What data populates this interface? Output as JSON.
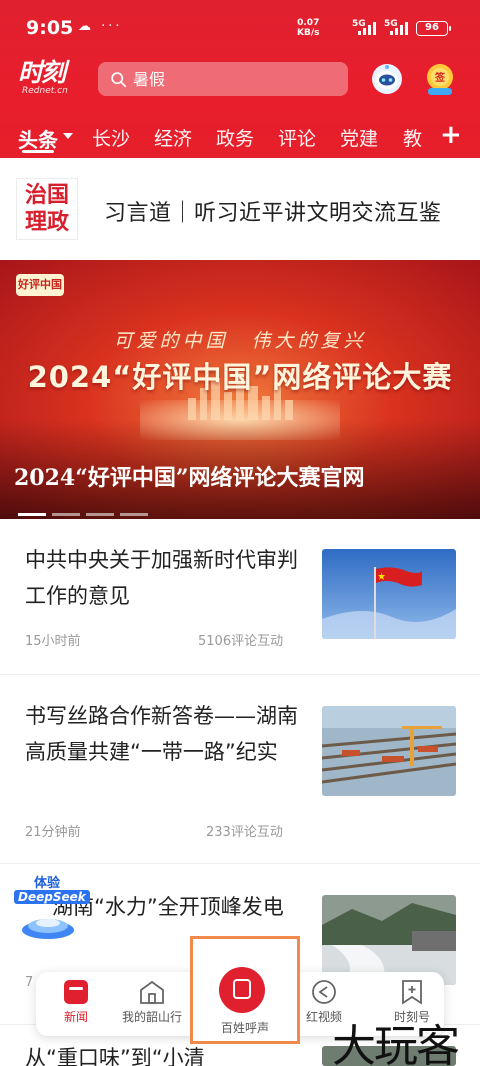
{
  "status_bar": {
    "time": "9:05",
    "notif_icons": "☁ ···",
    "net_speed_top": "0.07",
    "net_speed_bottom": "KB/s",
    "sig1": "5G",
    "sig2": "5G",
    "battery": "96"
  },
  "header": {
    "logo_text": "时刻",
    "logo_sub": "Rednet.cn",
    "search_placeholder": "暑假",
    "robot_icon": "assistant-robot-icon",
    "signin_icon": "signin-badge-icon"
  },
  "channels": [
    "头条",
    "长沙",
    "经济",
    "政务",
    "评论",
    "党建",
    "教"
  ],
  "feature": {
    "badge_line1": "治国",
    "badge_line2": "理政",
    "title": "习言道｜听习近平讲文明交流互鉴"
  },
  "banner": {
    "chip": "好评中国",
    "slogan": "可爱的中国　伟大的复兴",
    "big_title": "2024“好评中国”网络评论大赛",
    "caption": "2024“好评中国”网络评论大赛官网"
  },
  "news": [
    {
      "title": "中共中央关于加强新时代审判工作的意见",
      "time": "15小时前",
      "comments": "5106评论互动"
    },
    {
      "title": "书写丝路合作新答卷——湖南高质量共建“一带一路”纪实",
      "time": "21分钟前",
      "comments": "233评论互动"
    },
    {
      "title": "湖南“水力”全开顶峰发电",
      "time": "7"
    },
    {
      "title": "从“重口味”到“小清"
    }
  ],
  "deepseek": {
    "label_top": "体验",
    "label_brand": "DeepSeek"
  },
  "bottom_nav": {
    "items": [
      "新闻",
      "我的韶山行",
      "百姓呼声",
      "红视频",
      "时刻号"
    ],
    "active": "新闻"
  },
  "watermark": "大玩客",
  "colors": {
    "brand_red": "#e0202f",
    "highlight_orange": "#f0894a"
  }
}
